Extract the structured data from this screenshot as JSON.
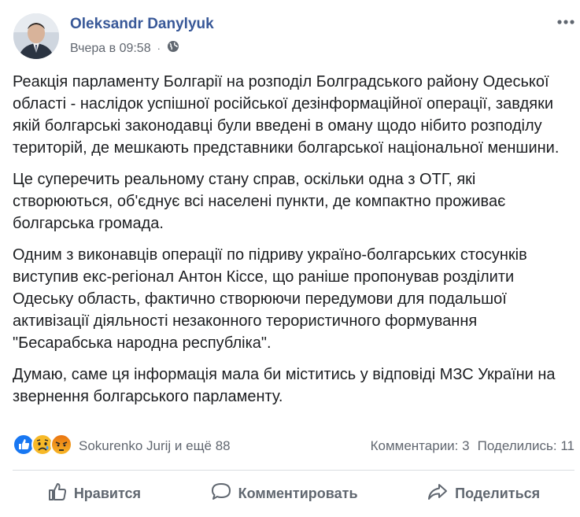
{
  "post": {
    "author": "Oleksandr Danylyuk",
    "timestamp": "Вчера в 09:58",
    "separator": "·",
    "privacy_icon": "globe-icon",
    "more_icon": "more-dots-icon",
    "paragraphs": [
      "Реакція парламенту Болгарії на розподіл Болградського району Одеської області - наслідок успішної російської дезінформаційної операції, завдяки якій болгарські законодавці були введені в оману щодо нібито розподілу територій, де мешкають представники болгарської національної меншини.",
      "Це суперечить реальному стану справ, оскільки одна з ОТГ, які створюються, об'єднує всі населені пункти, де компактно проживає болгарська громада.",
      "Одним з виконавців операції по підриву україно-болгарських стосунків виступив екс-регіонал Антон Кіссе, що раніше пропонував розділити Одеську область, фактично створюючи передумови для подальшої активізації діяльності незаконного терористичного формування \"Бесарабська народна республіка\".",
      "Думаю, саме ця інформація мала би міститись у відповіді МЗС України на звернення болгарського парламенту."
    ]
  },
  "reactions": {
    "icons": [
      "like-reaction-icon",
      "sad-reaction-icon",
      "angry-reaction-icon"
    ],
    "summary": "Sokurenko Jurij и ещё 88",
    "comments": "Комментарии: 3",
    "shares": "Поделились: 11"
  },
  "actions": {
    "like": "Нравится",
    "comment": "Комментировать",
    "share": "Поделиться"
  },
  "colors": {
    "author": "#385898",
    "meta": "#616770",
    "like_blue": "#1877f2",
    "sad_yellow": "#f7b928",
    "angry_red": "#e9710f"
  }
}
